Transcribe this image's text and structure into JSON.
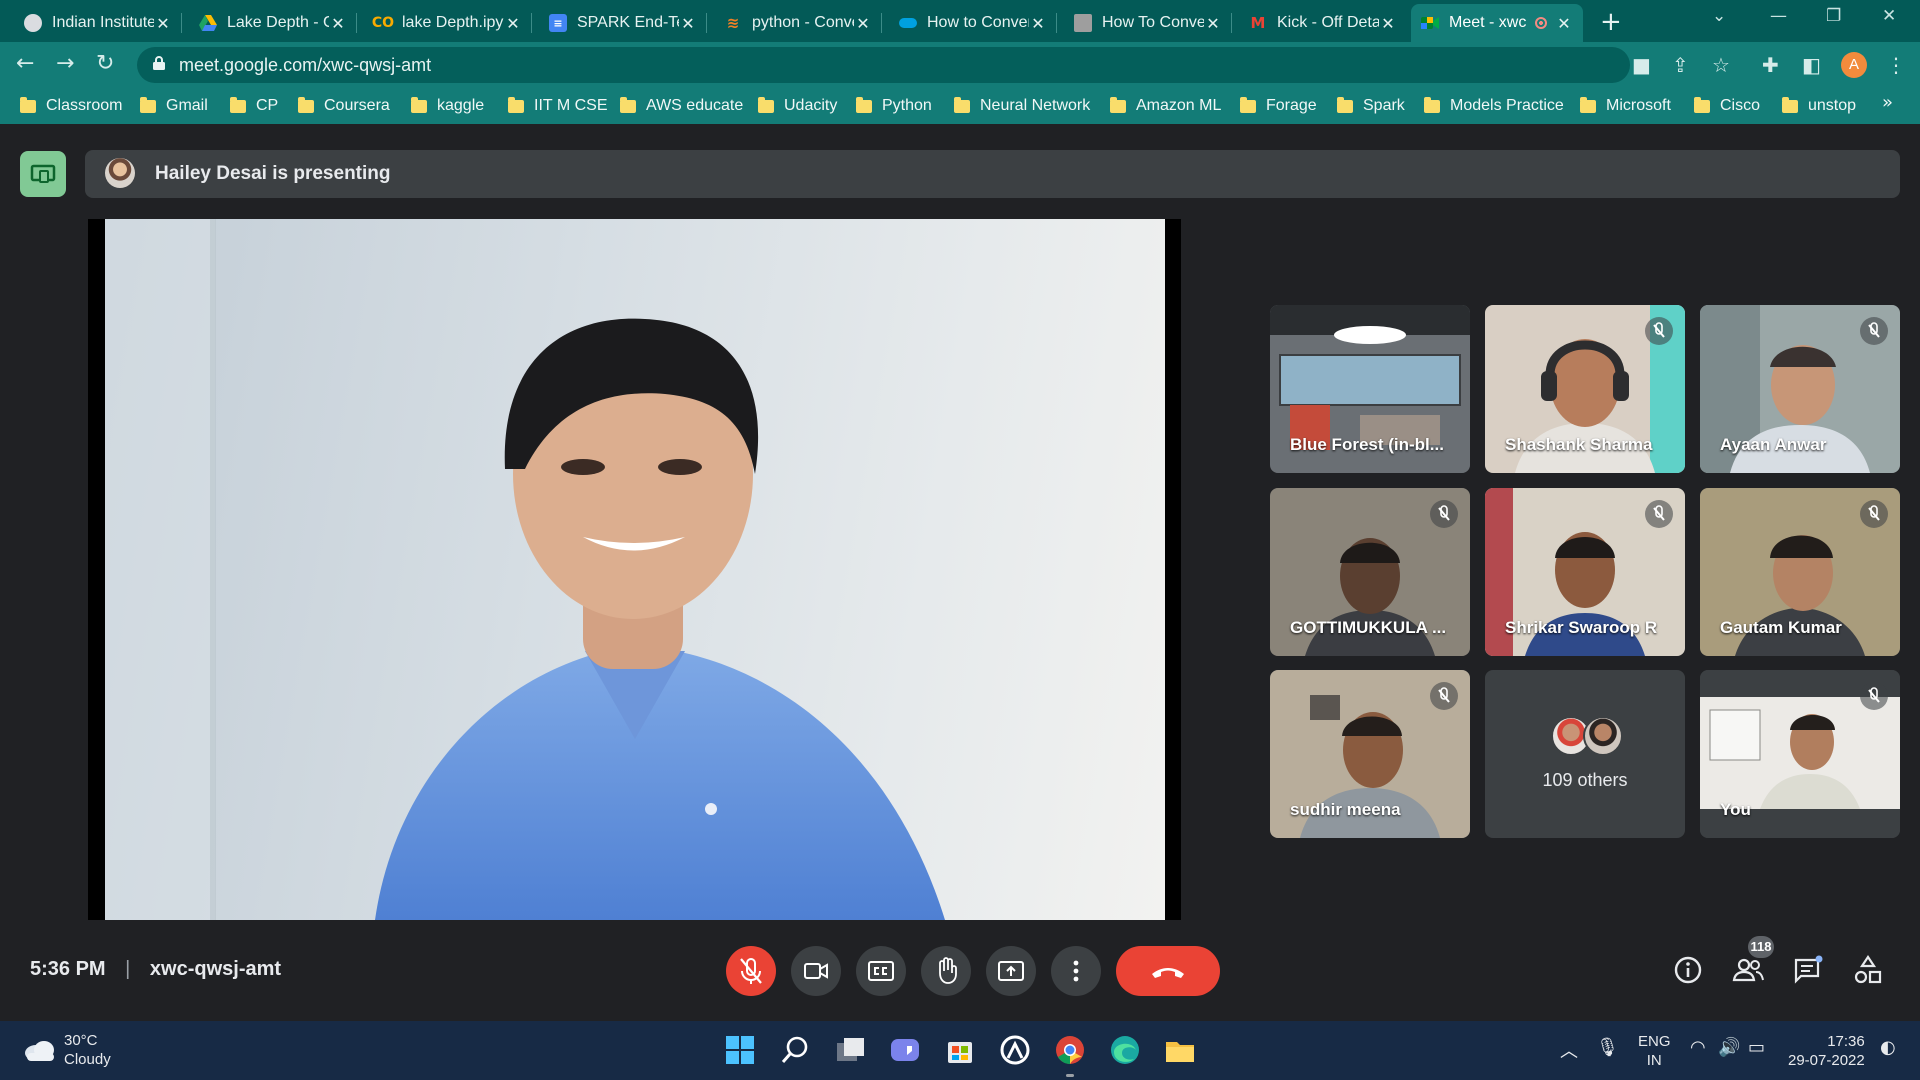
{
  "browser": {
    "tabs": [
      {
        "title": "Indian Institute",
        "favicon_color": "#dadce0",
        "active": false
      },
      {
        "title": "Lake Depth - Google Drive",
        "favicon_color": "#fbbc04",
        "active": false
      },
      {
        "title": "lake Depth.ipynb",
        "favicon_color": "#f9ab00",
        "active": false
      },
      {
        "title": "SPARK End-Term",
        "favicon_color": "#4285f4",
        "active": false
      },
      {
        "title": "python - Convert",
        "favicon_color": "#f48024",
        "active": false
      },
      {
        "title": "How to Convert",
        "favicon_color": "#00a1e0",
        "active": false
      },
      {
        "title": "How To Convert",
        "favicon_color": "#9e9e9e",
        "active": false
      },
      {
        "title": "Kick - Off Details",
        "favicon_color": "#ea4335",
        "active": false
      },
      {
        "title": "Meet - xwc",
        "favicon_color": "#00897b",
        "active": true
      }
    ],
    "new_tab_label": "+",
    "url": "meet.google.com/xwc-qwsj-amt",
    "profile_initial": "A",
    "bookmarks": [
      "Classroom",
      "Gmail",
      "CP",
      "Coursera",
      "kaggle",
      "IIT M CSE",
      "AWS educate",
      "Udacity",
      "Python",
      "Neural Network",
      "Amazon ML",
      "Forage",
      "Spark",
      "Models Practice",
      "Microsoft",
      "Cisco",
      "unstop"
    ]
  },
  "meet": {
    "presenting_text": "Hailey Desai is presenting",
    "participants": [
      {
        "name": "Blue Forest (in-bl...",
        "muted": false
      },
      {
        "name": "Shashank Sharma",
        "muted": true
      },
      {
        "name": "Ayaan Anwar",
        "muted": true
      },
      {
        "name": "GOTTIMUKKULA ...",
        "muted": true
      },
      {
        "name": "Shrikar Swaroop R",
        "muted": true
      },
      {
        "name": "Gautam Kumar",
        "muted": true
      },
      {
        "name": "sudhir meena",
        "muted": true
      },
      {
        "name": "109 others",
        "muted": false
      },
      {
        "name": "You",
        "muted": true
      }
    ],
    "time": "5:36 PM",
    "separator": "|",
    "meeting_code": "xwc-qwsj-amt",
    "people_count": "118",
    "controls": [
      "mic-off",
      "camera",
      "captions",
      "raise-hand",
      "present",
      "more-options",
      "leave-call"
    ],
    "right_controls": [
      "meeting-details",
      "people",
      "chat",
      "activities"
    ]
  },
  "taskbar": {
    "temperature": "30°C",
    "condition": "Cloudy",
    "language": "ENG",
    "region": "IN",
    "time": "17:36",
    "date": "29-07-2022"
  }
}
